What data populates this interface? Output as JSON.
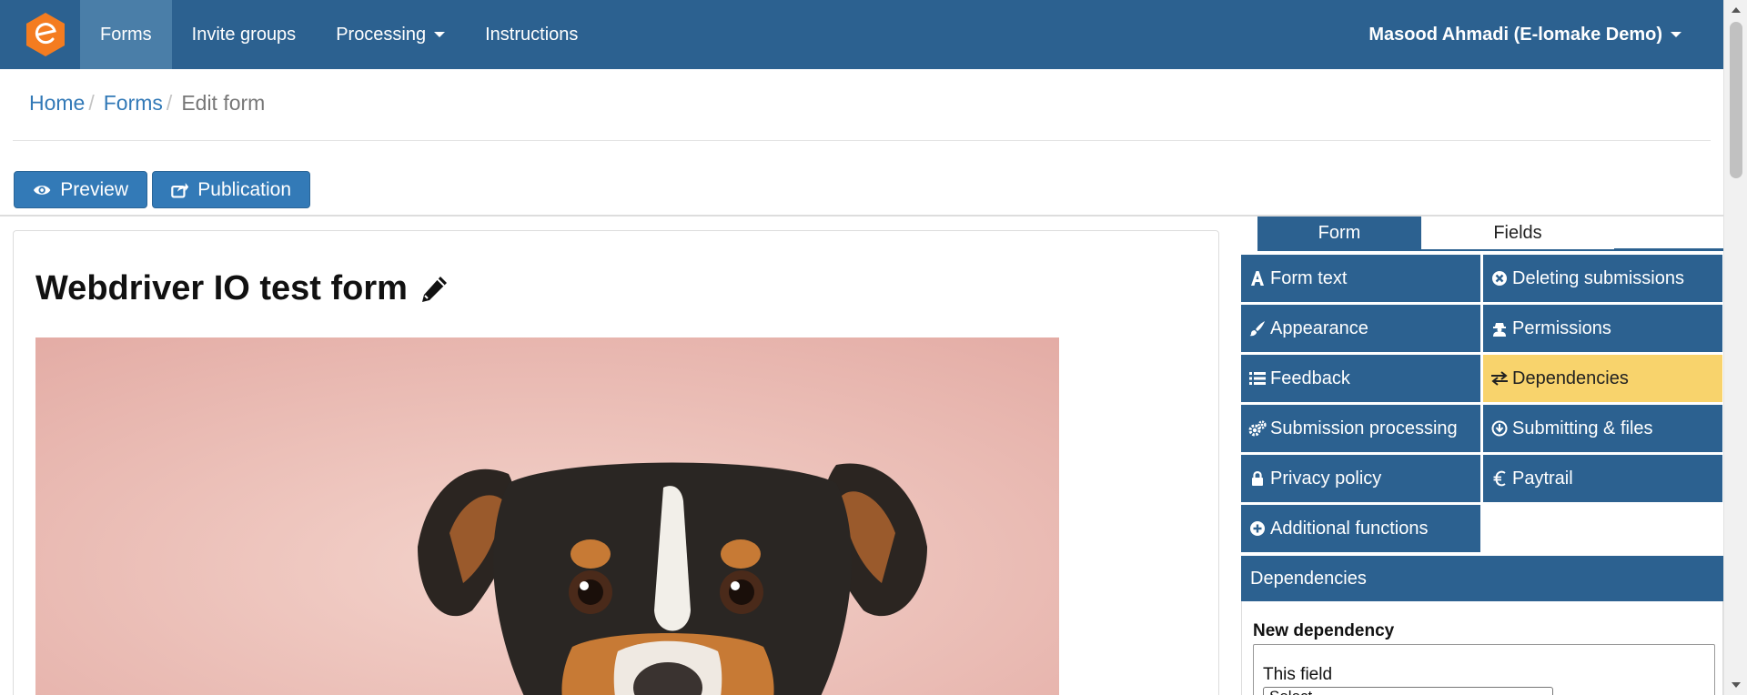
{
  "nav": {
    "items": [
      {
        "label": "Forms",
        "active": true
      },
      {
        "label": "Invite groups",
        "active": false
      },
      {
        "label": "Processing",
        "active": false,
        "dropdown": true
      },
      {
        "label": "Instructions",
        "active": false
      }
    ],
    "user": "Masood Ahmadi (E-lomake Demo)"
  },
  "breadcrumb": {
    "home": "Home",
    "forms": "Forms",
    "current": "Edit form",
    "separator": "/"
  },
  "toolbar": {
    "preview_label": "Preview",
    "publication_label": "Publication"
  },
  "form": {
    "title": "Webdriver IO test form"
  },
  "sidebar": {
    "tabs": [
      {
        "label": "Form",
        "active": true
      },
      {
        "label": "Fields",
        "active": false
      }
    ],
    "menu": [
      {
        "label": "Form text",
        "icon": "font-icon"
      },
      {
        "label": "Deleting submissions",
        "icon": "times-circle-icon"
      },
      {
        "label": "Appearance",
        "icon": "brush-icon"
      },
      {
        "label": "Permissions",
        "icon": "user-secret-icon"
      },
      {
        "label": "Feedback",
        "icon": "list-icon"
      },
      {
        "label": "Dependencies",
        "icon": "exchange-icon",
        "highlighted": true
      },
      {
        "label": "Submission processing",
        "icon": "cogs-icon"
      },
      {
        "label": "Submitting & files",
        "icon": "download-circle-icon"
      },
      {
        "label": "Privacy policy",
        "icon": "lock-icon"
      },
      {
        "label": "Paytrail",
        "icon": "euro-icon"
      },
      {
        "label": "Additional functions",
        "icon": "plus-circle-icon"
      }
    ],
    "dependencies": {
      "header": "Dependencies",
      "new_label": "New dependency",
      "this_field_label": "This field",
      "select_value": "Select..."
    }
  },
  "colors": {
    "navbar": "#2c6190",
    "nav_active": "#4a7ea8",
    "button": "#337ab7",
    "highlight": "#f8d36c",
    "logo": "#f47c20"
  }
}
